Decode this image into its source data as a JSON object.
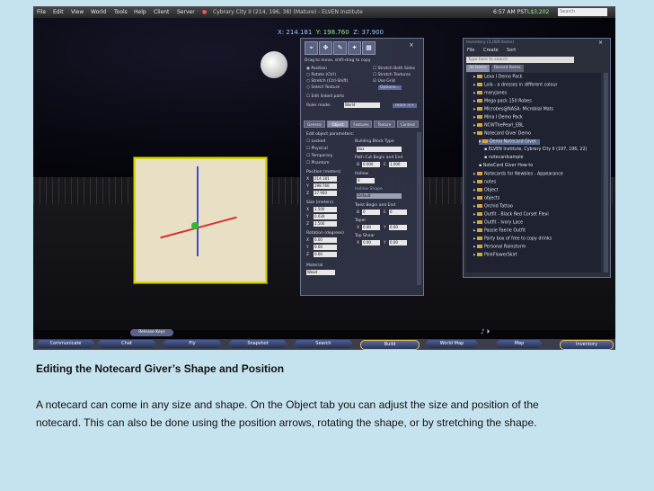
{
  "menubar": {
    "items": [
      "File",
      "Edit",
      "View",
      "World",
      "Tools",
      "Help",
      "Client",
      "Server"
    ],
    "location": "Cybrary City II (214, 196, 38) (Mature) - ELVEN Institute",
    "time": "6:57 AM PST",
    "balance": "L$3,202",
    "search_placeholder": "Search"
  },
  "viewer": {
    "coords": {
      "x": "X: 214.181",
      "y": "Y: 198.760",
      "z": "Z: 37.900"
    }
  },
  "build_panel": {
    "hint": "Drag to move, shift-drag to copy",
    "options": [
      "Position",
      "Rotate (Ctrl)",
      "Stretch (Ctrl-Shift)",
      "Select Texture"
    ],
    "right_options": [
      "Stretch Both Sides",
      "Stretch Textures",
      "Use Grid",
      "Options..."
    ],
    "edit_linked": "Edit linked parts",
    "ruler_label": "Ruler mode:",
    "ruler_value": "World",
    "more_btn": "more >>",
    "tabs": [
      "General",
      "Object",
      "Features",
      "Texture",
      "Content"
    ],
    "edit_params": "Edit object parameters:",
    "checks": [
      "Locked",
      "Physical",
      "Temporary",
      "Phantom"
    ],
    "position_label": "Position (meters)",
    "position": {
      "x": "214.181",
      "y": "198.760",
      "z": "37.900"
    },
    "size_label": "Size (meters)",
    "size": {
      "x": "1.500",
      "y": "0.030",
      "z": "1.500"
    },
    "rotation_label": "Rotation (degrees)",
    "rotation": {
      "x": "0.00",
      "y": "0.00",
      "z": "0.00"
    },
    "material_label": "Material",
    "material_value": "Wood",
    "block_type_label": "Building Block Type",
    "block_type_value": "Box",
    "path_cut_label": "Path Cut Begin and End",
    "path_cut": {
      "b": "0.000",
      "e": "1.000"
    },
    "hollow_label": "Hollow",
    "hollow_value": "0",
    "hollow_shape_label": "Hollow Shape",
    "hollow_shape_value": "Default",
    "twist_label": "Twist Begin and End",
    "twist": {
      "b": "0",
      "e": "0"
    },
    "taper_label": "Taper",
    "taper": {
      "x": "0.00",
      "y": "0.00"
    },
    "shear_label": "Top Shear",
    "shear": {
      "x": "0.00",
      "y": "0.00"
    }
  },
  "inventory": {
    "title": "Inventory (1,000 items)",
    "menus": [
      "File",
      "Create",
      "Sort"
    ],
    "search_placeholder": "Type here to search",
    "tabs": [
      "All Items",
      "Recent Items"
    ],
    "items": [
      "Lexa I Demo Pack",
      "Lola - a dresses in different colour",
      "maryjanes",
      "Mega pack 150 Robes",
      "Microbes@NASA: Microbial Mats",
      "Mina I Demo Pack",
      "NCWThePearl_EBL",
      "Notecard Giver Demo",
      "Demo Notecard Giver",
      "ELVEN Institute, Cybrary City II (197, 196, 22)",
      "notecardsample",
      "NoteCard Giver How-to",
      "Notecards for Newbies - Appearance",
      "notes",
      "Object",
      "objects",
      "Orchid Tattoo",
      "Outfit - Black Red Corset Flexi",
      "Outfit - Ivory Lace",
      "Passie Faerie Outfit",
      "Party box of free to copy drinks",
      "Personal Rainstorm",
      "PinkFlowerSkirt"
    ]
  },
  "bottombar": {
    "release_keys": "Release Keys",
    "buttons": [
      "Communicate",
      "Chat",
      "Fly",
      "Snapshot",
      "Search",
      "Build",
      "World Map",
      "Map",
      "Inventory"
    ]
  },
  "caption": {
    "heading": "Editing the Notecard Giver’s Shape and Position",
    "line1": "A notecard can come in any size and shape.  On the Object tab you can adjust the size and position of the",
    "line2": "notecard. This can also be done using the position arrows, rotating the shape, or by stretching the shape."
  }
}
